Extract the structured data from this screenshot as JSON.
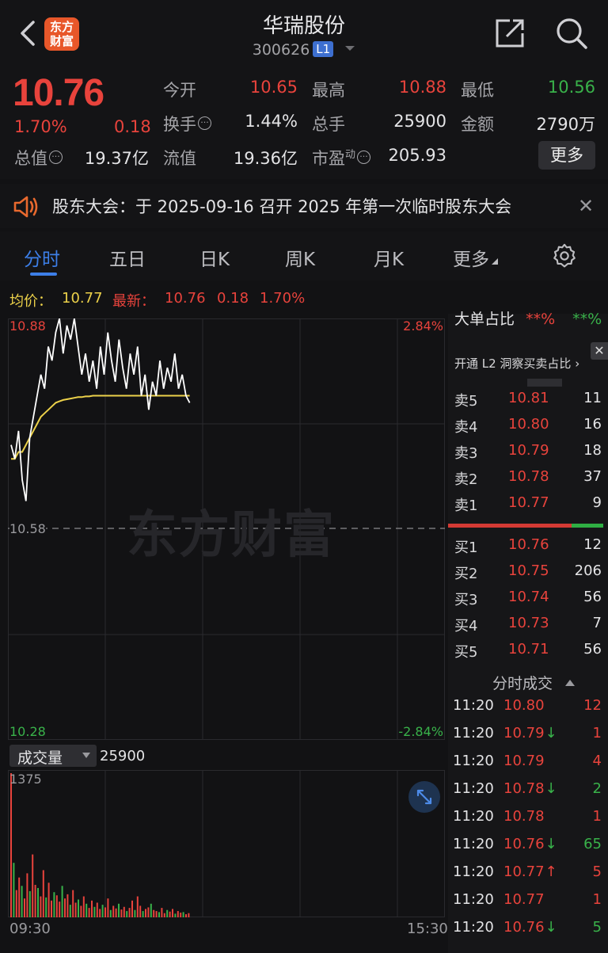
{
  "header": {
    "logo_text": "东方财富",
    "stock_name": "华瑞股份",
    "stock_code": "300626",
    "level_badge": "L1"
  },
  "quote": {
    "last_price": "10.76",
    "change_pct": "1.70%",
    "change_abs": "0.18",
    "open_label": "今开",
    "open": "10.65",
    "high_label": "最高",
    "high": "10.88",
    "low_label": "最低",
    "low": "10.56",
    "turnover_label": "换手",
    "turnover": "1.44%",
    "volume_label": "总手",
    "volume": "25900",
    "amount_label": "金额",
    "amount": "2790万",
    "mktcap_label": "总值",
    "mktcap": "19.37亿",
    "float_label": "流值",
    "float_cap": "19.36亿",
    "pe_label": "市盈",
    "pe_sup": "动",
    "pe": "205.93",
    "more_label": "更多"
  },
  "notice": {
    "text": "股东大会：于 2025-09-16 召开 2025 年第一次临时股东大会"
  },
  "tabs": [
    {
      "label": "分时"
    },
    {
      "label": "五日"
    },
    {
      "label": "日K"
    },
    {
      "label": "周K"
    },
    {
      "label": "月K"
    },
    {
      "label": "更多"
    }
  ],
  "avg_line": {
    "avg_label": "均价：",
    "avg_value": "10.77",
    "latest_label": "最新：",
    "latest_value": "10.76",
    "latest_chg": "0.18",
    "latest_pct": "1.70%"
  },
  "chart": {
    "y_top": "10.88",
    "y_mid": "10.58",
    "y_bottom": "10.28",
    "pct_top": "2.84%",
    "pct_bottom": "-2.84%",
    "watermark": "东方财富",
    "volume_label": "成交量",
    "volume_total": "25900",
    "volume_max": "1375",
    "x_start": "09:30",
    "x_end": "15:30"
  },
  "chart_data": {
    "type": "line",
    "x_range": [
      "09:30",
      "15:30"
    ],
    "ylim": [
      10.28,
      10.88
    ],
    "series": [
      {
        "values": [
          10.7,
          10.68,
          10.72,
          10.65,
          10.62,
          10.71,
          10.74,
          10.77,
          10.8,
          10.78,
          10.84,
          10.82,
          10.86,
          10.88,
          10.83,
          10.87,
          10.85,
          10.88,
          10.84,
          10.8,
          10.83,
          10.79,
          10.82,
          10.78,
          10.84,
          10.8,
          10.86,
          10.82,
          10.79,
          10.85,
          10.81,
          10.78,
          10.83,
          10.8,
          10.84,
          10.77,
          10.8,
          10.75,
          10.79,
          10.77,
          10.82,
          10.78,
          10.81,
          10.79,
          10.83,
          10.78,
          10.8,
          10.77,
          10.76
        ]
      },
      {
        "values": [
          10.68,
          10.68,
          10.69,
          10.69,
          10.7,
          10.71,
          10.72,
          10.73,
          10.74,
          10.745,
          10.75,
          10.755,
          10.76,
          10.762,
          10.764,
          10.765,
          10.766,
          10.767,
          10.768,
          10.768,
          10.769,
          10.769,
          10.77,
          10.77,
          10.77,
          10.77,
          10.77,
          10.77,
          10.77,
          10.77,
          10.77,
          10.77,
          10.77,
          10.77,
          10.77,
          10.77,
          10.77,
          10.77,
          10.77,
          10.77,
          10.77,
          10.77,
          10.77,
          10.77,
          10.77,
          10.77,
          10.77,
          10.77,
          10.77
        ]
      }
    ],
    "volume_ymax": 1375,
    "volume": [
      1375,
      520,
      260,
      380,
      300,
      180,
      420,
      250,
      600,
      310,
      280,
      200,
      450,
      190,
      330,
      160,
      240,
      210,
      150,
      300,
      180,
      220,
      120,
      260,
      140,
      170,
      110,
      200,
      130,
      90,
      160,
      100,
      140,
      80,
      120,
      95,
      180,
      70,
      110,
      85,
      130,
      75,
      100,
      60,
      90,
      160,
      70,
      200,
      110,
      60,
      80,
      95,
      130,
      70,
      60,
      50,
      90,
      40,
      70,
      55,
      80,
      35,
      60,
      45,
      50,
      30,
      40
    ]
  },
  "order_book": {
    "top_label": "大单占比",
    "top_v1": "**%",
    "top_v2": "**%",
    "l2_promo": "开通 L2 洞察买卖占比",
    "asks": [
      {
        "label": "卖5",
        "price": "10.81",
        "vol": "11"
      },
      {
        "label": "卖4",
        "price": "10.80",
        "vol": "16"
      },
      {
        "label": "卖3",
        "price": "10.79",
        "vol": "18"
      },
      {
        "label": "卖2",
        "price": "10.78",
        "vol": "37"
      },
      {
        "label": "卖1",
        "price": "10.77",
        "vol": "9"
      }
    ],
    "bids": [
      {
        "label": "买1",
        "price": "10.76",
        "vol": "12"
      },
      {
        "label": "买2",
        "price": "10.75",
        "vol": "206"
      },
      {
        "label": "买3",
        "price": "10.74",
        "vol": "56"
      },
      {
        "label": "买4",
        "price": "10.73",
        "vol": "7"
      },
      {
        "label": "买5",
        "price": "10.71",
        "vol": "56"
      }
    ],
    "ticks_label": "分时成交",
    "ticks": [
      {
        "time": "11:20",
        "price": "10.80",
        "arrow": "",
        "vol": "12",
        "vol_color": "red"
      },
      {
        "time": "11:20",
        "price": "10.79",
        "arrow": "↓",
        "vol": "1",
        "vol_color": "red"
      },
      {
        "time": "11:20",
        "price": "10.79",
        "arrow": "",
        "vol": "4",
        "vol_color": "red"
      },
      {
        "time": "11:20",
        "price": "10.78",
        "arrow": "↓",
        "vol": "2",
        "vol_color": "green"
      },
      {
        "time": "11:20",
        "price": "10.78",
        "arrow": "",
        "vol": "1",
        "vol_color": "red"
      },
      {
        "time": "11:20",
        "price": "10.76",
        "arrow": "↓",
        "vol": "65",
        "vol_color": "green"
      },
      {
        "time": "11:20",
        "price": "10.77",
        "arrow": "↑",
        "vol": "5",
        "vol_color": "red"
      },
      {
        "time": "11:20",
        "price": "10.77",
        "arrow": "",
        "vol": "1",
        "vol_color": "red"
      },
      {
        "time": "11:20",
        "price": "10.76",
        "arrow": "↓",
        "vol": "5",
        "vol_color": "green"
      }
    ]
  },
  "colors": {
    "up": "#e8433c",
    "down": "#39b24a",
    "avg": "#ecd14a",
    "price_line": "#ffffff",
    "accent": "#3d7fe8"
  }
}
